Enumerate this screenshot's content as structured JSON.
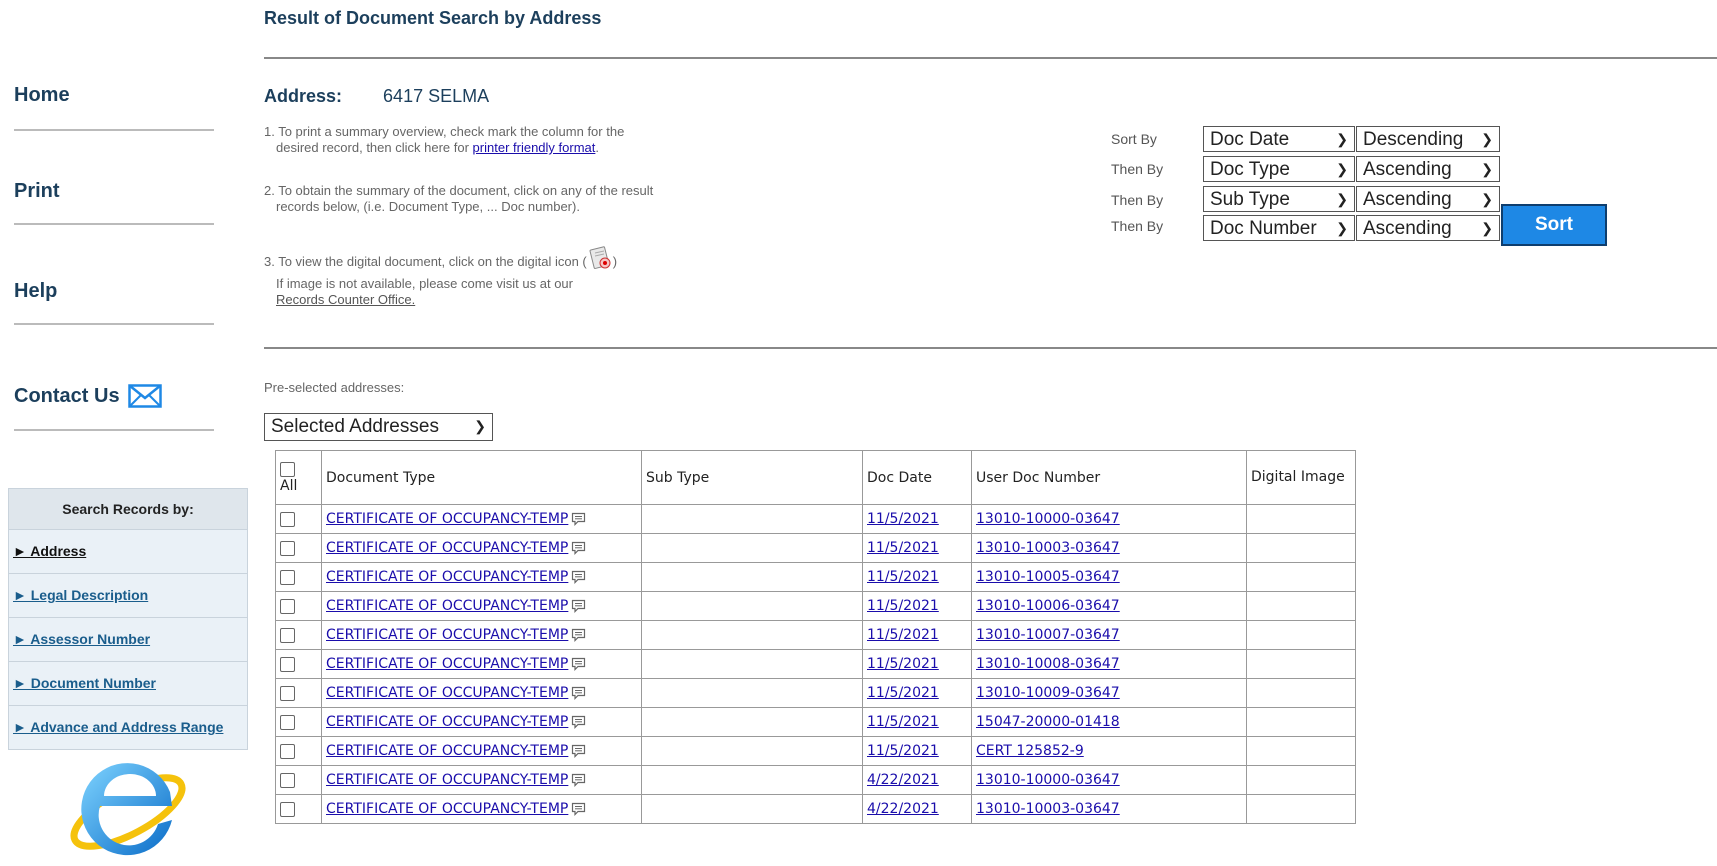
{
  "page": {
    "title": "Result of Document Search by Address"
  },
  "nav": {
    "home": "Home",
    "print": "Print",
    "help": "Help",
    "contact": "Contact Us"
  },
  "search_records": {
    "header": "Search Records by:",
    "items": [
      {
        "label": "► Address"
      },
      {
        "label": "► Legal Description"
      },
      {
        "label": "► Assessor Number"
      },
      {
        "label": "► Document Number"
      },
      {
        "label": "► Advance and Address Range"
      }
    ]
  },
  "address": {
    "label": "Address:",
    "value": "6417 SELMA"
  },
  "instructions": {
    "step1_a": "1. To print a summary overview, check mark the column for the",
    "step1_b": "desired record, then click here for ",
    "step1_link": "printer friendly format",
    "step1_c": ".",
    "step2_a": "2. To obtain the summary of the document, click on any of the result",
    "step2_b": "records below, (i.e. Document Type, ... Doc number).",
    "step3_a": "3. To view the digital document, click on the digital icon (",
    "step3_b": ")",
    "step3_c": "If image is not available, please come visit us at our",
    "step3_link": "Records Counter Office."
  },
  "sort": {
    "rows": [
      {
        "label": "Sort By",
        "field": "Doc Date",
        "order": "Descending"
      },
      {
        "label": "Then By",
        "field": "Doc Type",
        "order": "Ascending"
      },
      {
        "label": "Then By",
        "field": "Sub Type",
        "order": "Ascending"
      },
      {
        "label": "Then By",
        "field": "Doc Number",
        "order": "Ascending"
      }
    ],
    "button": "Sort"
  },
  "preselected": {
    "label": "Pre-selected addresses:",
    "value": "Selected Addresses"
  },
  "table": {
    "headers": {
      "all": "All",
      "doc_type": "Document Type",
      "sub_type": "Sub Type",
      "doc_date": "Doc Date",
      "user_doc_number": "User Doc Number",
      "digital_image": "Digital Image"
    },
    "rows": [
      {
        "doc_type": "CERTIFICATE OF OCCUPANCY-TEMP",
        "sub_type": "",
        "doc_date": "11/5/2021",
        "doc_number": "13010-10000-03647"
      },
      {
        "doc_type": "CERTIFICATE OF OCCUPANCY-TEMP",
        "sub_type": "",
        "doc_date": "11/5/2021",
        "doc_number": "13010-10003-03647"
      },
      {
        "doc_type": "CERTIFICATE OF OCCUPANCY-TEMP",
        "sub_type": "",
        "doc_date": "11/5/2021",
        "doc_number": "13010-10005-03647"
      },
      {
        "doc_type": "CERTIFICATE OF OCCUPANCY-TEMP",
        "sub_type": "",
        "doc_date": "11/5/2021",
        "doc_number": "13010-10006-03647"
      },
      {
        "doc_type": "CERTIFICATE OF OCCUPANCY-TEMP",
        "sub_type": "",
        "doc_date": "11/5/2021",
        "doc_number": "13010-10007-03647"
      },
      {
        "doc_type": "CERTIFICATE OF OCCUPANCY-TEMP",
        "sub_type": "",
        "doc_date": "11/5/2021",
        "doc_number": "13010-10008-03647"
      },
      {
        "doc_type": "CERTIFICATE OF OCCUPANCY-TEMP",
        "sub_type": "",
        "doc_date": "11/5/2021",
        "doc_number": "13010-10009-03647"
      },
      {
        "doc_type": "CERTIFICATE OF OCCUPANCY-TEMP",
        "sub_type": "",
        "doc_date": "11/5/2021",
        "doc_number": "15047-20000-01418"
      },
      {
        "doc_type": "CERTIFICATE OF OCCUPANCY-TEMP",
        "sub_type": "",
        "doc_date": "11/5/2021",
        "doc_number": "CERT 125852-9"
      },
      {
        "doc_type": "CERTIFICATE OF OCCUPANCY-TEMP",
        "sub_type": "",
        "doc_date": "4/22/2021",
        "doc_number": "13010-10000-03647"
      },
      {
        "doc_type": "CERTIFICATE OF OCCUPANCY-TEMP",
        "sub_type": "",
        "doc_date": "4/22/2021",
        "doc_number": "13010-10003-03647"
      }
    ]
  },
  "icons": {
    "contact": "mail-icon",
    "digital": "digital-document-icon",
    "comment": "comment-icon",
    "browser": "internet-explorer-logo-icon"
  }
}
